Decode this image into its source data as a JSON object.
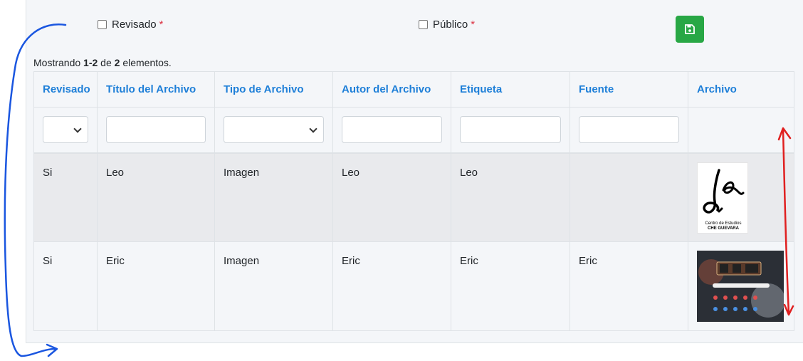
{
  "form": {
    "revisado_label": "Revisado",
    "publico_label": "Público",
    "required_marker": "*"
  },
  "summary": {
    "prefix": "Mostrando ",
    "range": "1-2",
    "middle": " de ",
    "total": "2",
    "suffix": " elementos."
  },
  "table": {
    "headers": [
      "Revisado",
      "Título del Archivo",
      "Tipo de Archivo",
      "Autor del Archivo",
      "Etiqueta",
      "Fuente",
      "Archivo"
    ],
    "rows": [
      {
        "revisado": "Si",
        "titulo": "Leo",
        "tipo": "Imagen",
        "autor": "Leo",
        "etiqueta": "Leo",
        "fuente": ""
      },
      {
        "revisado": "Si",
        "titulo": "Eric",
        "tipo": "Imagen",
        "autor": "Eric",
        "etiqueta": "Eric",
        "fuente": "Eric"
      }
    ]
  },
  "thumbnails": {
    "leo_caption_1": "Centro de Estudios",
    "leo_caption_2": "CHE GUEVARA"
  },
  "colors": {
    "accent": "#1e7fd8",
    "save": "#28a745",
    "required": "#dc3545",
    "annotation_blue": "#1a56e0",
    "annotation_red": "#e02020"
  }
}
